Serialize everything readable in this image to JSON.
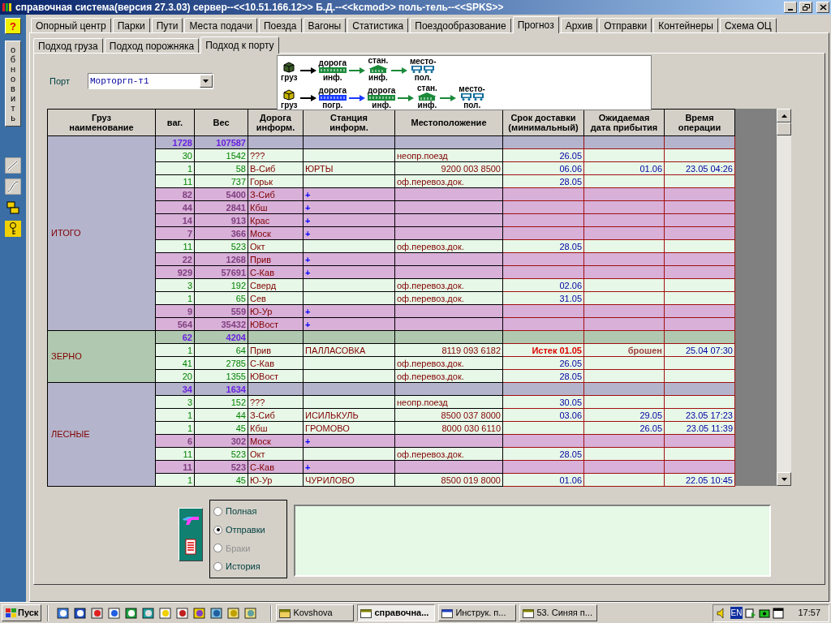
{
  "window": {
    "title": "справочная система(версия 27.3.03) сервер--<<10.51.166.12>> Б.Д.--<<kcmod>> поль-тель--<<SPKS>>"
  },
  "toolbar": {
    "help": "?",
    "refresh": "обновить"
  },
  "tabs": [
    {
      "label": "Опорный центр",
      "selected": false
    },
    {
      "label": "Парки",
      "selected": false
    },
    {
      "label": "Пути",
      "selected": false
    },
    {
      "label": "Места подачи",
      "selected": false
    },
    {
      "label": "Поезда",
      "selected": false
    },
    {
      "label": "Вагоны",
      "selected": false
    },
    {
      "label": "Статистика",
      "selected": false
    },
    {
      "label": "Поездообразование",
      "selected": false
    },
    {
      "label": "Прогноз",
      "selected": true
    },
    {
      "label": "Архив",
      "selected": false
    },
    {
      "label": "Отправки",
      "selected": false
    },
    {
      "label": "Контейнеры",
      "selected": false
    },
    {
      "label": "Схема ОЦ",
      "selected": false
    }
  ],
  "subtabs": [
    {
      "label": "Подход груза",
      "selected": false
    },
    {
      "label": "Подход порожняка",
      "selected": false
    },
    {
      "label": "Подход к порту",
      "selected": true
    }
  ],
  "port": {
    "label": "Порт",
    "value": "Морторгп-т1"
  },
  "legend": {
    "rows": [
      {
        "steps": [
          {
            "kind": "cargo",
            "color": "#3c5a28",
            "bottom": "груз"
          },
          {
            "kind": "road",
            "color": "#1a8a3a",
            "top": "дорога",
            "bottom": "инф."
          },
          {
            "kind": "station",
            "color": "#1a8a3a",
            "top": "стан.",
            "bottom": "инф."
          },
          {
            "kind": "place",
            "color": "#0a6a9a",
            "top": "место-",
            "bottom": "пол."
          }
        ]
      },
      {
        "steps": [
          {
            "kind": "cargo",
            "color": "#c8b400",
            "bottom": "груз"
          },
          {
            "kind": "road",
            "color": "#1a3aff",
            "top": "дорога",
            "bottom": "погр."
          },
          {
            "kind": "road",
            "color": "#1a8a3a",
            "top": "дорога",
            "bottom": "инф."
          },
          {
            "kind": "station",
            "color": "#1a8a3a",
            "top": "стан.",
            "bottom": "инф."
          },
          {
            "kind": "place",
            "color": "#0a6a9a",
            "top": "место-",
            "bottom": "пол."
          }
        ]
      }
    ]
  },
  "table": {
    "columns": [
      "Груз\nнаименование",
      "ваг.",
      "Вес",
      "Дорога\nинформ.",
      "Станция\nинформ.",
      "Местоположение",
      "Срок доставки\n(минимальный)",
      "Ожидаемая\nдата прибытия",
      "Время\nоперации"
    ],
    "groups": [
      {
        "name": "ИТОГО",
        "color": "#b4b4cc",
        "rows": [
          {
            "kind": "summary",
            "wagons": "1728",
            "weight": "107587"
          },
          {
            "kind": "info",
            "wagons": "30",
            "weight": "1542",
            "road": "???",
            "location": "неопр.поезд",
            "delivery": "26.05"
          },
          {
            "kind": "info",
            "wagons": "1",
            "weight": "58",
            "road": "В-Сиб",
            "station": "ЮРТЫ",
            "location": "9200 003 8500",
            "delivery": "06.06",
            "expected": "01.06",
            "time": "23.05 04:26"
          },
          {
            "kind": "info",
            "wagons": "11",
            "weight": "737",
            "road": "Горьк",
            "location": "оф.перевоз.док.",
            "delivery": "28.05"
          },
          {
            "kind": "noinfo",
            "wagons": "82",
            "weight": "5400",
            "road": "З-Сиб",
            "station": "+"
          },
          {
            "kind": "noinfo",
            "wagons": "44",
            "weight": "2841",
            "road": "Кбш",
            "station": "+"
          },
          {
            "kind": "noinfo",
            "wagons": "14",
            "weight": "913",
            "road": "Крас",
            "station": "+"
          },
          {
            "kind": "noinfo",
            "wagons": "7",
            "weight": "366",
            "road": "Моск",
            "station": "+"
          },
          {
            "kind": "info",
            "wagons": "11",
            "weight": "523",
            "road": "Окт",
            "location": "оф.перевоз.док.",
            "delivery": "28.05"
          },
          {
            "kind": "noinfo",
            "wagons": "22",
            "weight": "1268",
            "road": "Прив",
            "station": "+"
          },
          {
            "kind": "noinfo",
            "wagons": "929",
            "weight": "57691",
            "road": "С-Кав",
            "station": "+"
          },
          {
            "kind": "info",
            "wagons": "3",
            "weight": "192",
            "road": "Сверд",
            "location": "оф.перевоз.док.",
            "delivery": "02.06"
          },
          {
            "kind": "info",
            "wagons": "1",
            "weight": "65",
            "road": "Сев",
            "location": "оф.перевоз.док.",
            "delivery": "31.05"
          },
          {
            "kind": "noinfo",
            "wagons": "9",
            "weight": "559",
            "road": "Ю-Ур",
            "station": "+"
          },
          {
            "kind": "noinfo",
            "wagons": "564",
            "weight": "35432",
            "road": "ЮВост",
            "station": "+"
          }
        ]
      },
      {
        "name": "ЗЕРНО",
        "color": "#b0c8b0",
        "rows": [
          {
            "kind": "summary",
            "wagons": "62",
            "weight": "4204"
          },
          {
            "kind": "overdue",
            "wagons": "1",
            "weight": "64",
            "road": "Прив",
            "station": "ПАЛЛАСОВКА",
            "location": "8119 093 6182",
            "delivery": "Истек 01.05",
            "expected": "брошен",
            "time": "25.04 07:30"
          },
          {
            "kind": "info",
            "wagons": "41",
            "weight": "2785",
            "road": "С-Кав",
            "location": "оф.перевоз.док.",
            "delivery": "26.05"
          },
          {
            "kind": "info",
            "wagons": "20",
            "weight": "1355",
            "road": "ЮВост",
            "location": "оф.перевоз.док.",
            "delivery": "28.05"
          }
        ]
      },
      {
        "name": "ЛЕСНЫЕ",
        "color": "#b4b4cc",
        "rows": [
          {
            "kind": "summary",
            "wagons": "34",
            "weight": "1634"
          },
          {
            "kind": "info",
            "wagons": "3",
            "weight": "152",
            "road": "???",
            "location": "неопр.поезд",
            "delivery": "30.05"
          },
          {
            "kind": "info",
            "wagons": "1",
            "weight": "44",
            "road": "З-Сиб",
            "station": "ИСИЛЬКУЛЬ",
            "location": "8500 037 8000",
            "delivery": "03.06",
            "expected": "29.05",
            "time": "23.05 17:23"
          },
          {
            "kind": "info",
            "wagons": "1",
            "weight": "45",
            "road": "Кбш",
            "station": "ГРОМОВО",
            "location": "8000 030 6110",
            "expected": "26.05",
            "time": "23.05 11:39"
          },
          {
            "kind": "noinfo",
            "wagons": "6",
            "weight": "302",
            "road": "Моск",
            "station": "+"
          },
          {
            "kind": "info",
            "wagons": "11",
            "weight": "523",
            "road": "Окт",
            "location": "оф.перевоз.док.",
            "delivery": "28.05"
          },
          {
            "kind": "noinfo",
            "wagons": "11",
            "weight": "523",
            "road": "С-Кав",
            "station": "+"
          },
          {
            "kind": "info",
            "wagons": "1",
            "weight": "45",
            "road": "Ю-Ур",
            "station": "ЧУРИЛОВО",
            "location": "8500 019 8000",
            "delivery": "01.06",
            "time": "22.05 10:45"
          }
        ]
      }
    ]
  },
  "report_options": [
    {
      "label": "Полная",
      "selected": false,
      "disabled": false
    },
    {
      "label": "Отправки",
      "selected": true,
      "disabled": false
    },
    {
      "label": "Браки",
      "selected": false,
      "disabled": true
    },
    {
      "label": "История",
      "selected": false,
      "disabled": false
    }
  ],
  "taskbar": {
    "start": "Пуск",
    "tasks": [
      {
        "label": "Kovshova",
        "selected": false
      },
      {
        "label": "справочна...",
        "selected": true
      },
      {
        "label": "Инструк. п...",
        "selected": false
      },
      {
        "label": "53. Синяя п...",
        "selected": false
      }
    ],
    "language": "EN",
    "clock": "17:57"
  }
}
